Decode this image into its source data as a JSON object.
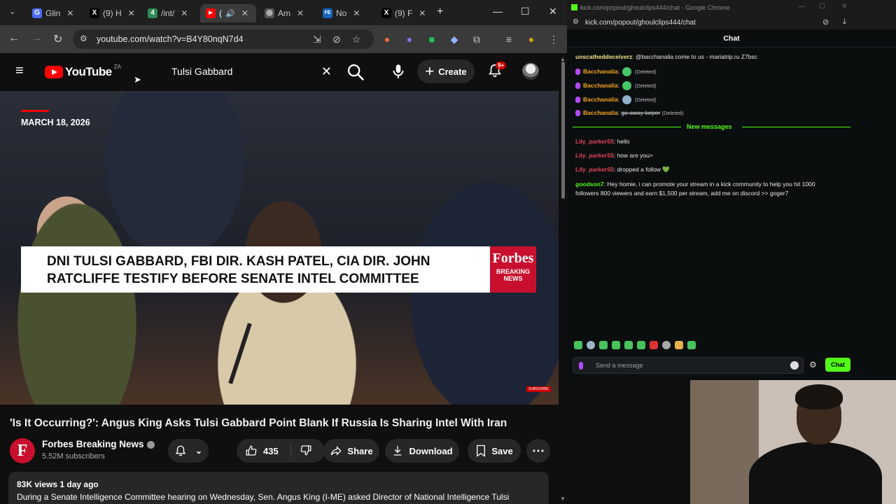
{
  "browser": {
    "tabs": [
      {
        "label": "Glin",
        "fav": "G",
        "color": "#4a6cf7"
      },
      {
        "label": "(9) H",
        "fav": "X",
        "color": "#000000"
      },
      {
        "label": "/int/",
        "fav": "4",
        "color": "#2e8b57"
      },
      {
        "label": "(",
        "fav": "▶",
        "color": "#ff0000"
      },
      {
        "label": "Am",
        "fav": "◎",
        "color": "#555555"
      },
      {
        "label": "No",
        "fav": "FE",
        "color": "#1565c0"
      },
      {
        "label": "(9) F",
        "fav": "X",
        "color": "#000000"
      }
    ],
    "new_tab": "+",
    "url": "youtube.com/watch?v=B4Y80nqN7d4"
  },
  "youtube": {
    "logo_text": "YouTube",
    "country_code": "ZA",
    "search_query": "Tulsi Gabbard",
    "create_label": "Create",
    "notification_count": "9+",
    "video": {
      "date": "MARCH 18, 2026",
      "headline": "DNI Tulsi Gabbard, FBI Dir. Kash Patel, CIA Dir. John Ratcliffe Testify Before Senate Intel Committee",
      "badge_brand": "Forbes",
      "badge_sub": "BREAKING NEWS",
      "subscribe_tag": "SUBSCRIBE"
    },
    "title": "'Is It Occurring?': Angus King Asks Tulsi Gabbard Point Blank If Russia Is Sharing Intel With Iran",
    "channel": {
      "logo_letter": "F",
      "name": "Forbes Breaking News",
      "subscribers": "5.52M subscribers"
    },
    "actions": {
      "likes": "435",
      "share": "Share",
      "download": "Download",
      "save": "Save"
    },
    "description": {
      "meta": "83K views  1 day ago",
      "text": "During a Senate Intelligence Committee hearing on Wednesday, Sen. Angus King (I-ME) asked Director of National Intelligence Tulsi"
    }
  },
  "chat_popout": {
    "window_title": "kick.com/popout/ghoulclips444/chat - Google Chrome",
    "url": "kick.com/popout/ghoulclips444/chat",
    "header": "Chat",
    "messages_top": [
      {
        "user": "unscatheddeceiverz",
        "color": "#f2e38a",
        "text": "@bacchanalia come to us - mariatrip.ru Z7bsc"
      },
      {
        "user": "Bacchanalia",
        "color": "#f5a623",
        "text": "(Deleted)"
      },
      {
        "user": "Bacchanalia",
        "color": "#f5a623",
        "text": "(Deleted)"
      },
      {
        "user": "Bacchanalia",
        "color": "#f5a623",
        "text": "(Deleted)"
      }
    ],
    "strike_message": {
      "user": "Bacchanalia",
      "struck": "go away larper",
      "suffix": "(Deleted)"
    },
    "new_messages_label": "New messages",
    "messages_new": [
      {
        "user": "Lily_parker55",
        "color": "#e0455a",
        "text": "hello"
      },
      {
        "user": "Lily_parker55",
        "color": "#e0455a",
        "text": "how are you>"
      },
      {
        "user": "Lily_parker55",
        "color": "#e0455a",
        "text": "dropped a follow 💚"
      }
    ],
    "promo": {
      "user": "goodson7",
      "color": "#53fc18",
      "line1": "Hey homie, i can promote your stream in a kick community to help you hit 1000",
      "line2": "followers 800 viewers and earn $1,500 per stream, add me on discord >> goger7"
    },
    "input_placeholder": "Send a message",
    "send_label": "Chat"
  }
}
